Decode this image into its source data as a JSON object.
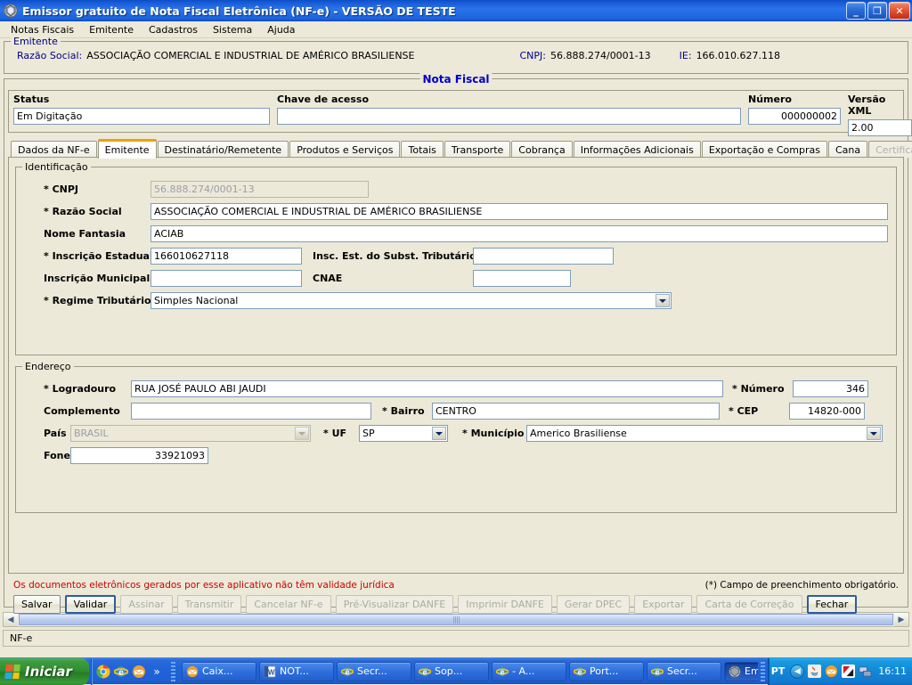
{
  "window": {
    "title": "Emissor gratuito de Nota Fiscal Eletrônica (NF-e) - VERSÃO DE TESTE",
    "app_icon": "nfe-app-icon",
    "minimize_label": "_",
    "restore_label": "❐",
    "close_label": "✕"
  },
  "menubar": {
    "items": [
      {
        "label": "Notas Fiscais"
      },
      {
        "label": "Emitente"
      },
      {
        "label": "Cadastros"
      },
      {
        "label": "Sistema"
      },
      {
        "label": "Ajuda"
      }
    ]
  },
  "emitente_band": {
    "legend": "Emitente",
    "razao_social_label": "Razão Social:",
    "razao_social_value": "ASSOCIAÇÃO COMERCIAL E INDUSTRIAL DE AMÉRICO BRASILIENSE",
    "cnpj_label": "CNPJ:",
    "cnpj_value": "56.888.274/0001-13",
    "ie_label": "IE:",
    "ie_value": "166.010.627.118"
  },
  "nota_fiscal": {
    "legend": "Nota Fiscal",
    "status_label": "Status",
    "status_value": "Em Digitação",
    "chave_label": "Chave de acesso",
    "chave_value": "",
    "numero_label": "Número",
    "numero_value": "000000002",
    "versao_label": "Versão XML",
    "versao_value": "2.00"
  },
  "tabs": [
    {
      "label": "Dados da NF-e",
      "state": "normal"
    },
    {
      "label": "Emitente",
      "state": "active"
    },
    {
      "label": "Destinatário/Remetente",
      "state": "normal"
    },
    {
      "label": "Produtos e Serviços",
      "state": "normal"
    },
    {
      "label": "Totais",
      "state": "normal"
    },
    {
      "label": "Transporte",
      "state": "normal"
    },
    {
      "label": "Cobrança",
      "state": "normal"
    },
    {
      "label": "Informações Adicionais",
      "state": "normal"
    },
    {
      "label": "Exportação e Compras",
      "state": "normal"
    },
    {
      "label": "Cana",
      "state": "normal"
    },
    {
      "label": "Certificado Digital",
      "state": "disabled"
    }
  ],
  "identificacao": {
    "legend": "Identificação",
    "cnpj_label": "* CNPJ",
    "cnpj_value": "56.888.274/0001-13",
    "razao_label": "* Razão Social",
    "razao_value": "ASSOCIAÇÃO COMERCIAL E INDUSTRIAL DE AMÉRICO BRASILIENSE",
    "fantasia_label": "Nome Fantasia",
    "fantasia_value": "ACIAB",
    "ie_label": "* Inscrição Estadual",
    "ie_value": "166010627118",
    "ie_st_label": "Insc. Est. do Subst. Tributário",
    "ie_st_value": "",
    "im_label": "Inscrição Municipal",
    "im_value": "",
    "cnae_label": "CNAE",
    "cnae_value": "",
    "regime_label": "* Regime Tributário",
    "regime_value": "Simples Nacional"
  },
  "endereco": {
    "legend": "Endereço",
    "logradouro_label": "* Logradouro",
    "logradouro_value": "RUA JOSÉ PAULO ABI JAUDI",
    "numero_label": "* Número",
    "numero_value": "346",
    "complemento_label": "Complemento",
    "complemento_value": "",
    "bairro_label": "* Bairro",
    "bairro_value": "CENTRO",
    "cep_label": "* CEP",
    "cep_value": "14820-000",
    "pais_label": "País",
    "pais_value": "BRASIL",
    "uf_label": "* UF",
    "uf_value": "SP",
    "municipio_label": "* Município",
    "municipio_value": "Americo Brasiliense",
    "fone_label": "Fone",
    "fone_value": "33921093"
  },
  "notices": {
    "warning": "Os documentos eletrônicos gerados por esse aplicativo não têm validade jurídica",
    "required": "(*) Campo de preenchimento obrigatório."
  },
  "buttons": [
    {
      "label": "Salvar",
      "state": "enabled"
    },
    {
      "label": "Validar",
      "state": "enabled"
    },
    {
      "label": "Assinar",
      "state": "disabled"
    },
    {
      "label": "Transmitir",
      "state": "disabled"
    },
    {
      "label": "Cancelar NF-e",
      "state": "disabled"
    },
    {
      "label": "Pré-Visualizar DANFE",
      "state": "disabled"
    },
    {
      "label": "Imprimir DANFE",
      "state": "disabled"
    },
    {
      "label": "Gerar DPEC",
      "state": "disabled"
    },
    {
      "label": "Exportar",
      "state": "disabled"
    },
    {
      "label": "Carta de Correção",
      "state": "disabled"
    },
    {
      "label": "Fechar",
      "state": "enabled"
    }
  ],
  "statusbar": {
    "text": "NF-e"
  },
  "taskbar": {
    "start_label": "Iniciar",
    "quicklaunch": [
      {
        "icon": "chrome-icon"
      },
      {
        "icon": "internet-explorer-icon"
      },
      {
        "icon": "outlook-express-icon"
      },
      {
        "icon": "more-chevron-icon"
      }
    ],
    "tasks": [
      {
        "label": "Caix...",
        "icon": "outlook-express-icon",
        "state": "normal"
      },
      {
        "label": "NOT...",
        "icon": "word-icon",
        "state": "normal"
      },
      {
        "label": "Secr...",
        "icon": "internet-explorer-icon",
        "state": "normal"
      },
      {
        "label": "Sop...",
        "icon": "internet-explorer-icon",
        "state": "normal"
      },
      {
        "label": "- A...",
        "icon": "internet-explorer-icon",
        "state": "normal"
      },
      {
        "label": "Port...",
        "icon": "internet-explorer-icon",
        "state": "normal"
      },
      {
        "label": "Secr...",
        "icon": "internet-explorer-icon",
        "state": "normal"
      },
      {
        "label": "Emis...",
        "icon": "nfe-app-icon",
        "state": "active"
      }
    ],
    "language": "PT",
    "tray_icons": [
      {
        "icon": "show-hidden-icons-chevron"
      },
      {
        "icon": "java-icon"
      },
      {
        "icon": "outlook-express-icon"
      },
      {
        "icon": "kaspersky-icon"
      },
      {
        "icon": "network-icon"
      }
    ],
    "clock": "16:11"
  },
  "colors": {
    "desktop_chrome": "#ECE9D8",
    "titlebar_blue": "#2B73E8",
    "legend_blue": "#000080",
    "accent_orange": "#F0A000",
    "warning_red": "#CC0000",
    "field_border": "#7F9DB9"
  }
}
